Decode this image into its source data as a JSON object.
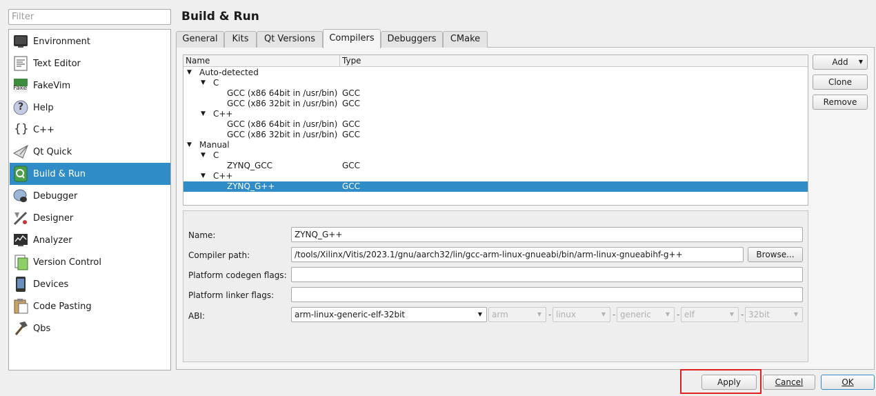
{
  "filter": {
    "placeholder": "Filter"
  },
  "sidebar": {
    "items": [
      {
        "label": "Environment",
        "icon": "monitor-icon"
      },
      {
        "label": "Text Editor",
        "icon": "text-editor-icon"
      },
      {
        "label": "FakeVim",
        "icon": "fakevim-icon",
        "icon_text": "Fake"
      },
      {
        "label": "Help",
        "icon": "help-icon",
        "icon_text": "?"
      },
      {
        "label": "C++",
        "icon": "braces-icon",
        "icon_text": "{}"
      },
      {
        "label": "Qt Quick",
        "icon": "paper-plane-icon"
      },
      {
        "label": "Build & Run",
        "icon": "build-run-icon",
        "selected": true
      },
      {
        "label": "Debugger",
        "icon": "debugger-icon"
      },
      {
        "label": "Designer",
        "icon": "designer-icon"
      },
      {
        "label": "Analyzer",
        "icon": "analyzer-icon"
      },
      {
        "label": "Version Control",
        "icon": "version-control-icon"
      },
      {
        "label": "Devices",
        "icon": "devices-icon"
      },
      {
        "label": "Code Pasting",
        "icon": "code-pasting-icon"
      },
      {
        "label": "Qbs",
        "icon": "hammer-icon"
      }
    ]
  },
  "page_title": "Build & Run",
  "tabs": [
    "General",
    "Kits",
    "Qt Versions",
    "Compilers",
    "Debuggers",
    "CMake"
  ],
  "selected_tab": "Compilers",
  "tree": {
    "columns": [
      "Name",
      "Type"
    ],
    "rows": [
      {
        "name": "Auto-detected",
        "type": "",
        "level": 0,
        "expander": "▼"
      },
      {
        "name": "C",
        "type": "",
        "level": 1,
        "expander": "▼"
      },
      {
        "name": "GCC (x86 64bit in /usr/bin)",
        "type": "GCC",
        "level": 2
      },
      {
        "name": "GCC (x86 32bit in /usr/bin)",
        "type": "GCC",
        "level": 2
      },
      {
        "name": "C++",
        "type": "",
        "level": 1,
        "expander": "▼"
      },
      {
        "name": "GCC (x86 64bit in /usr/bin)",
        "type": "GCC",
        "level": 2
      },
      {
        "name": "GCC (x86 32bit in /usr/bin)",
        "type": "GCC",
        "level": 2
      },
      {
        "name": "Manual",
        "type": "",
        "level": 0,
        "expander": "▼"
      },
      {
        "name": "C",
        "type": "",
        "level": 1,
        "expander": "▼"
      },
      {
        "name": "ZYNQ_GCC",
        "type": "GCC",
        "level": 2
      },
      {
        "name": "C++",
        "type": "",
        "level": 1,
        "expander": "▼"
      },
      {
        "name": "ZYNQ_G++",
        "type": "GCC",
        "level": 2,
        "selected": true
      }
    ]
  },
  "side_buttons": {
    "add": "Add",
    "clone": "Clone",
    "remove": "Remove"
  },
  "details": {
    "name_label": "Name:",
    "name_value": "ZYNQ_G++",
    "compiler_path_label": "Compiler path:",
    "compiler_path_value": "/tools/Xilinx/Vitis/2023.1/gnu/aarch32/lin/gcc-arm-linux-gnueabi/bin/arm-linux-gnueabihf-g++",
    "browse_label": "Browse...",
    "codegen_label": "Platform codegen flags:",
    "codegen_value": "",
    "linker_label": "Platform linker flags:",
    "linker_value": "",
    "abi_label": "ABI:",
    "abi_value": "arm-linux-generic-elf-32bit",
    "abi_parts": [
      "arm",
      "linux",
      "generic",
      "elf",
      "32bit"
    ],
    "abi_separator": "-"
  },
  "dialog_buttons": {
    "apply": "Apply",
    "cancel": "Cancel",
    "ok": "OK"
  },
  "colors": {
    "selection": "#308cc6",
    "highlight_box": "#e02020"
  }
}
